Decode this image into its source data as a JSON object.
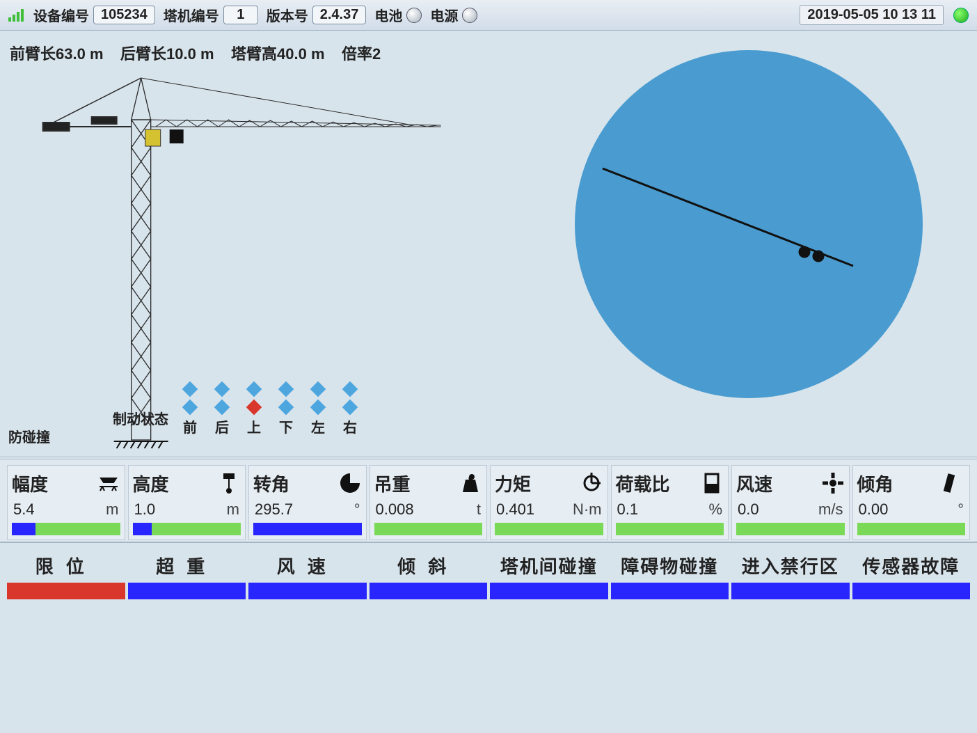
{
  "header": {
    "device_label": "设备编号",
    "device_id": "105234",
    "crane_label": "塔机编号",
    "crane_id": "1",
    "version_label": "版本号",
    "version": "2.4.37",
    "battery_label": "电池",
    "power_label": "电源",
    "datetime": "2019-05-05 10 13 11"
  },
  "summary": {
    "front_arm_label": "前臂长",
    "front_arm_value": "63.0",
    "back_arm_label": "后臂长",
    "back_arm_value": "10.0",
    "tower_height_label": "塔臂高",
    "tower_height_value": "40.0",
    "length_unit": "m",
    "rate_label": "倍率",
    "rate_value": "2"
  },
  "anti_collision_label": "防碰撞",
  "brake": {
    "title": "制动状态",
    "columns": [
      "前",
      "后",
      "上",
      "下",
      "左",
      "右"
    ],
    "row1": [
      "blue",
      "blue",
      "blue",
      "blue",
      "blue",
      "blue"
    ],
    "row2": [
      "blue",
      "blue",
      "red",
      "blue",
      "blue",
      "blue"
    ]
  },
  "radar": {
    "angle_deg": 295.7
  },
  "metrics": [
    {
      "label": "幅度",
      "icon": "amplitude-icon",
      "value": "5.4",
      "unit": "m",
      "bar": "partial",
      "fill_pct": 22
    },
    {
      "label": "高度",
      "icon": "height-icon",
      "value": "1.0",
      "unit": "m",
      "bar": "partial",
      "fill_pct": 18
    },
    {
      "label": "转角",
      "icon": "angle-icon",
      "value": "295.7",
      "unit": "°",
      "bar": "blue",
      "fill_pct": 100
    },
    {
      "label": "吊重",
      "icon": "weight-icon",
      "value": "0.008",
      "unit": "t",
      "bar": "green",
      "fill_pct": 0
    },
    {
      "label": "力矩",
      "icon": "torque-icon",
      "value": "0.401",
      "unit": "N·m",
      "bar": "green",
      "fill_pct": 0
    },
    {
      "label": "荷载比",
      "icon": "load-icon",
      "value": "0.1",
      "unit": "%",
      "bar": "green",
      "fill_pct": 0
    },
    {
      "label": "风速",
      "icon": "wind-icon",
      "value": "0.0",
      "unit": "m/s",
      "bar": "green",
      "fill_pct": 0
    },
    {
      "label": "倾角",
      "icon": "tilt-icon",
      "value": "0.00",
      "unit": "°",
      "bar": "green",
      "fill_pct": 0
    }
  ],
  "alerts": [
    {
      "label": "限位",
      "spread": true,
      "color": "red"
    },
    {
      "label": "超重",
      "spread": true,
      "color": "blue"
    },
    {
      "label": "风速",
      "spread": true,
      "color": "blue"
    },
    {
      "label": "倾斜",
      "spread": true,
      "color": "blue"
    },
    {
      "label": "塔机间碰撞",
      "spread": false,
      "color": "blue"
    },
    {
      "label": "障碍物碰撞",
      "spread": false,
      "color": "blue"
    },
    {
      "label": "进入禁行区",
      "spread": false,
      "color": "blue"
    },
    {
      "label": "传感器故障",
      "spread": false,
      "color": "blue"
    }
  ]
}
